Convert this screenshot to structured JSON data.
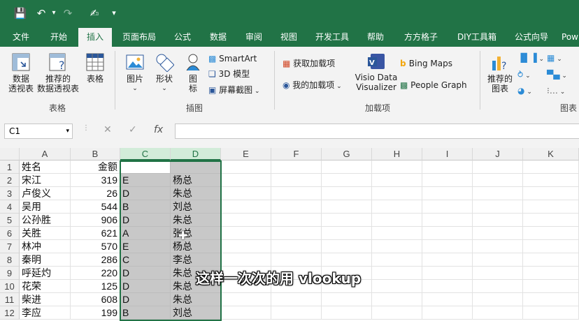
{
  "qat": {
    "icons": [
      "save-icon",
      "undo-icon",
      "redo-icon",
      "touch-mode-icon",
      "customize-icon"
    ]
  },
  "tabs": [
    "文件",
    "开始",
    "插入",
    "页面布局",
    "公式",
    "数据",
    "审阅",
    "视图",
    "开发工具",
    "帮助",
    "方方格子",
    "DIY工具箱",
    "公式向导",
    "Pow"
  ],
  "active_tab": "插入",
  "ribbon": {
    "tables": {
      "pivot": "数据\n透视表",
      "recommended_pivot": "推荐的\n数据透视表",
      "table": "表格",
      "group": "表格"
    },
    "illustrations": {
      "pictures": "图片",
      "shapes": "形状",
      "icons": "图\n标",
      "smartart": "SmartArt",
      "model3d": "3D 模型",
      "screenshot": "屏幕截图",
      "group": "插图"
    },
    "addins": {
      "get": "获取加载项",
      "my": "我的加载项",
      "visio": "Visio Data\nVisualizer",
      "bing": "Bing Maps",
      "people": "People Graph",
      "group": "加载项"
    },
    "charts": {
      "recommended": "推荐的\n图表",
      "group": "图表"
    }
  },
  "formula_bar": {
    "name_box": "C1",
    "fx": "fx",
    "value": ""
  },
  "columns": [
    "A",
    "B",
    "C",
    "D",
    "E",
    "F",
    "G",
    "H",
    "I",
    "J",
    "K"
  ],
  "rows": [
    [
      "姓名",
      "金额",
      "",
      ""
    ],
    [
      "宋江",
      "319",
      "E",
      "杨总"
    ],
    [
      "卢俊义",
      "26",
      "D",
      "朱总"
    ],
    [
      "吴用",
      "544",
      "B",
      "刘总"
    ],
    [
      "公孙胜",
      "906",
      "D",
      "朱总"
    ],
    [
      "关胜",
      "621",
      "A",
      "张总"
    ],
    [
      "林冲",
      "570",
      "E",
      "杨总"
    ],
    [
      "秦明",
      "286",
      "C",
      "李总"
    ],
    [
      "呼延灼",
      "220",
      "D",
      "朱总"
    ],
    [
      "花荣",
      "125",
      "D",
      "朱总"
    ],
    [
      "柴进",
      "608",
      "D",
      "朱总"
    ],
    [
      "李应",
      "199",
      "B",
      "刘总"
    ]
  ],
  "subtitle": "这样一次次的用 vlookup",
  "colors": {
    "excel_green": "#217346",
    "selection_gray": "#c8c8c8"
  }
}
